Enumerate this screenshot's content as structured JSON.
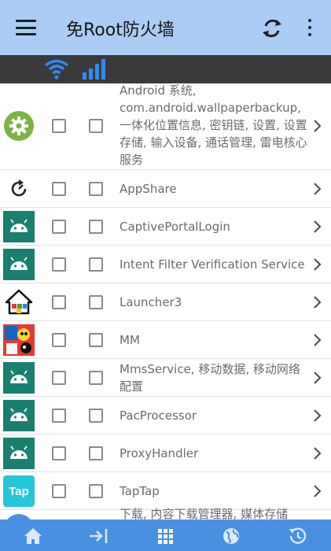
{
  "appbar": {
    "title": "免Root防火墙"
  },
  "apps": [
    {
      "name": "Android 系统, com.android.wallpaperbackup, 一体化位置信息, 密钥链, 设置, 设置存储, 输入设备, 通话管理, 雷电核心服务",
      "icon": "settings-gear-icon"
    },
    {
      "name": "AppShare",
      "icon": "appshare-icon"
    },
    {
      "name": "CaptivePortalLogin",
      "icon": "android-icon"
    },
    {
      "name": "Intent Filter Verification Service",
      "icon": "android-icon"
    },
    {
      "name": "Launcher3",
      "icon": "home-launcher-icon"
    },
    {
      "name": "MM",
      "icon": "mm-app-icon"
    },
    {
      "name": "MmsService, 移动数据, 移动网络配置",
      "icon": "android-icon"
    },
    {
      "name": "PacProcessor",
      "icon": "android-icon"
    },
    {
      "name": "ProxyHandler",
      "icon": "android-icon"
    },
    {
      "name": "TapTap",
      "icon": "taptap-icon",
      "icon_text": "Tap"
    },
    {
      "name": "下载, 内容下载管理器, 媒体存储",
      "icon": "download-icon"
    }
  ],
  "colors": {
    "appbar": "#a9cdf3",
    "filterbar": "#3a3a3a",
    "bottombar": "#4a90e2",
    "accent": "#4a90e2"
  }
}
